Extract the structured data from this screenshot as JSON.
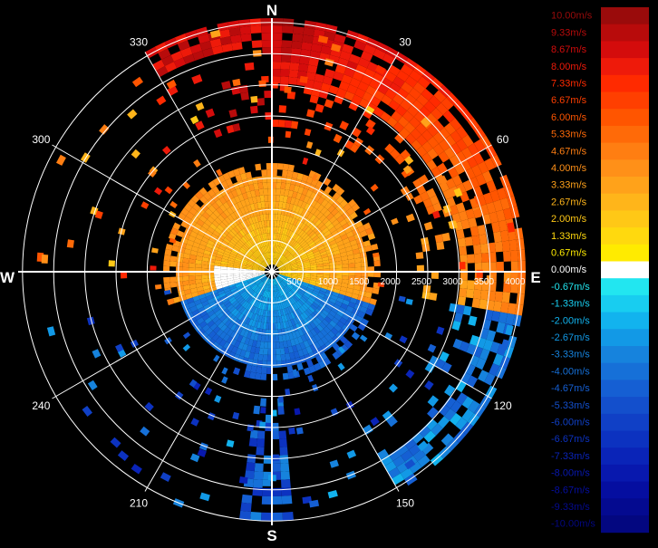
{
  "compass": {
    "north": "N",
    "south": "S",
    "east": "E",
    "west": "W"
  },
  "azimuth_labels": [
    {
      "deg": 30,
      "text": "30"
    },
    {
      "deg": 60,
      "text": "60"
    },
    {
      "deg": 120,
      "text": "120"
    },
    {
      "deg": 150,
      "text": "150"
    },
    {
      "deg": 210,
      "text": "210"
    },
    {
      "deg": 240,
      "text": "240"
    },
    {
      "deg": 300,
      "text": "300"
    },
    {
      "deg": 330,
      "text": "330"
    }
  ],
  "range_labels": [
    "500",
    "1000",
    "1500",
    "2000",
    "2500",
    "3000",
    "3500",
    "4000"
  ],
  "legend": [
    {
      "label": "10.00m/s",
      "color": "#9a0b0b"
    },
    {
      "label": "9.33m/s",
      "color": "#b80b0b"
    },
    {
      "label": "8.67m/s",
      "color": "#d40c0c"
    },
    {
      "label": "8.00m/s",
      "color": "#ee1a0a"
    },
    {
      "label": "7.33m/s",
      "color": "#ff2a00"
    },
    {
      "label": "6.67m/s",
      "color": "#ff3f00"
    },
    {
      "label": "6.00m/s",
      "color": "#ff5500"
    },
    {
      "label": "5.33m/s",
      "color": "#ff6a08"
    },
    {
      "label": "4.67m/s",
      "color": "#ff7e12"
    },
    {
      "label": "4.00m/s",
      "color": "#ff9018"
    },
    {
      "label": "3.33m/s",
      "color": "#ffa21a"
    },
    {
      "label": "2.67m/s",
      "color": "#ffb51a"
    },
    {
      "label": "2.00m/s",
      "color": "#ffc816"
    },
    {
      "label": "1.33m/s",
      "color": "#ffd90e"
    },
    {
      "label": "0.67m/s",
      "color": "#ffeb00"
    },
    {
      "label": "0.00m/s",
      "color": "#ffffff"
    },
    {
      "label": "-0.67m/s",
      "color": "#22e6f0"
    },
    {
      "label": "-1.33m/s",
      "color": "#18cdf0"
    },
    {
      "label": "-2.00m/s",
      "color": "#12b3ee"
    },
    {
      "label": "-2.67m/s",
      "color": "#1299e6"
    },
    {
      "label": "-3.33m/s",
      "color": "#1683dd"
    },
    {
      "label": "-4.00m/s",
      "color": "#1670d8"
    },
    {
      "label": "-4.67m/s",
      "color": "#155fd3"
    },
    {
      "label": "-5.33m/s",
      "color": "#134fcc"
    },
    {
      "label": "-6.00m/s",
      "color": "#1040c6"
    },
    {
      "label": "-6.67m/s",
      "color": "#0c32c0"
    },
    {
      "label": "-7.33m/s",
      "color": "#0a24b8"
    },
    {
      "label": "-8.00m/s",
      "color": "#0818ae"
    },
    {
      "label": "-8.67m/s",
      "color": "#050ea0"
    },
    {
      "label": "-9.33m/s",
      "color": "#040a90"
    },
    {
      "label": "-10.00m/s",
      "color": "#030780"
    }
  ]
}
